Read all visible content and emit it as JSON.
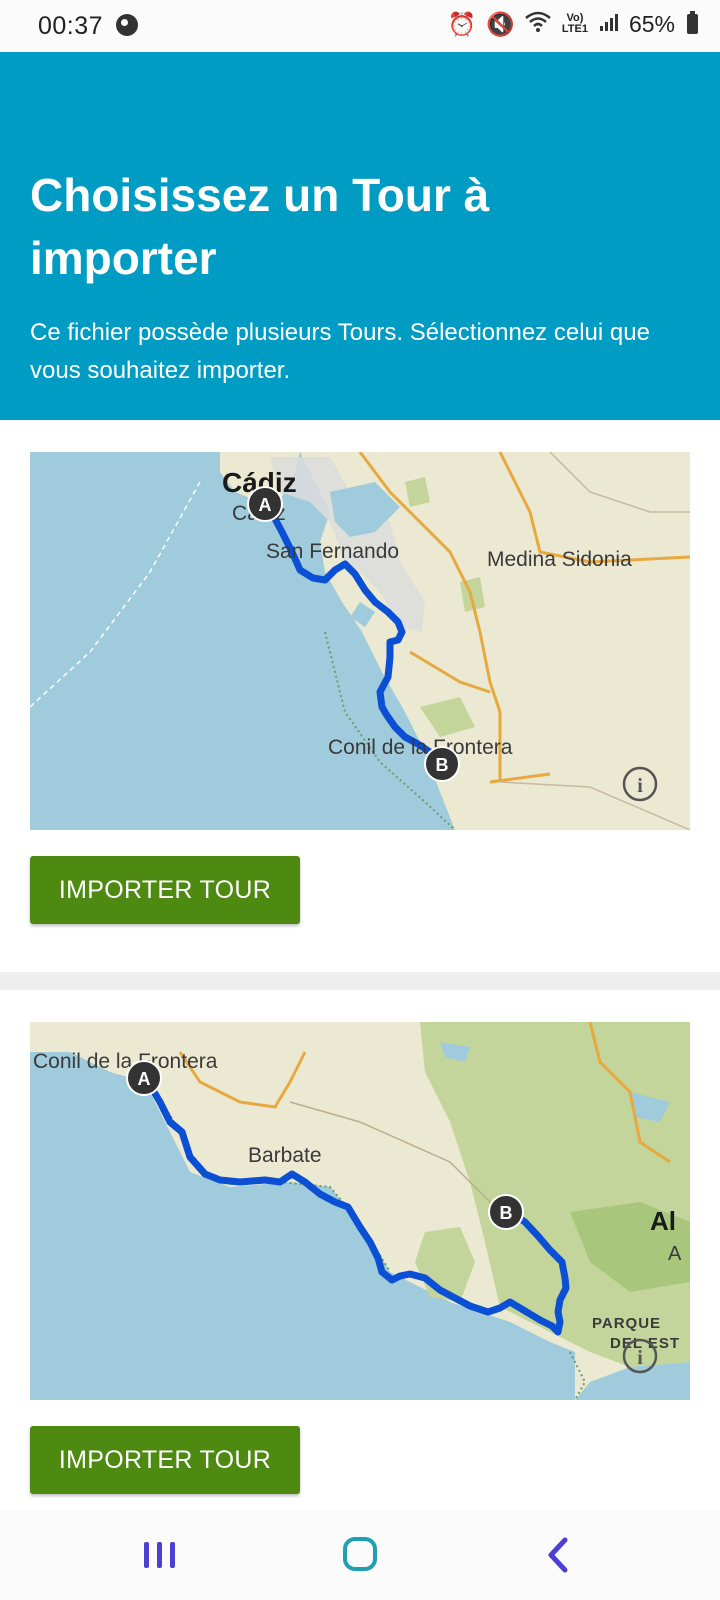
{
  "status_bar": {
    "time": "00:37",
    "battery": "65%",
    "network": "Vo) LTE1",
    "icons": [
      "alarm-icon",
      "mute-icon",
      "wifi-icon",
      "signal-icon",
      "battery-icon"
    ]
  },
  "header": {
    "title": "Choisissez un Tour à importer",
    "subtitle": "Ce fichier possède plusieurs Tours. Sélectionnez celui que vous souhaitez importer.",
    "background": "#019cc3"
  },
  "tours": [
    {
      "map_labels": {
        "city_main": "Cádiz",
        "city_main_sub": "Cádiz",
        "town1": "San Fernando",
        "town2": "Medina Sidonia",
        "town3": "Conil de la Frontera"
      },
      "marker_start": "A",
      "marker_end": "B",
      "button_label": "IMPORTER TOUR"
    },
    {
      "map_labels": {
        "town1": "Conil de la Frontera",
        "town2": "Barbate",
        "edge_city": "Al",
        "edge_city_sub": "A",
        "park_line1": "PARQUE",
        "park_line2": "DEL EST"
      },
      "marker_start": "A",
      "marker_end": "B",
      "button_label": "IMPORTER TOUR"
    }
  ],
  "colors": {
    "route": "#0a4fd4",
    "button": "#4e8a12",
    "sea": "#9fcbdc",
    "land": "#ece9d2",
    "forest": "#c3d59a"
  },
  "nav_bar": {
    "icons": [
      "recents-icon",
      "home-icon",
      "back-icon"
    ]
  }
}
